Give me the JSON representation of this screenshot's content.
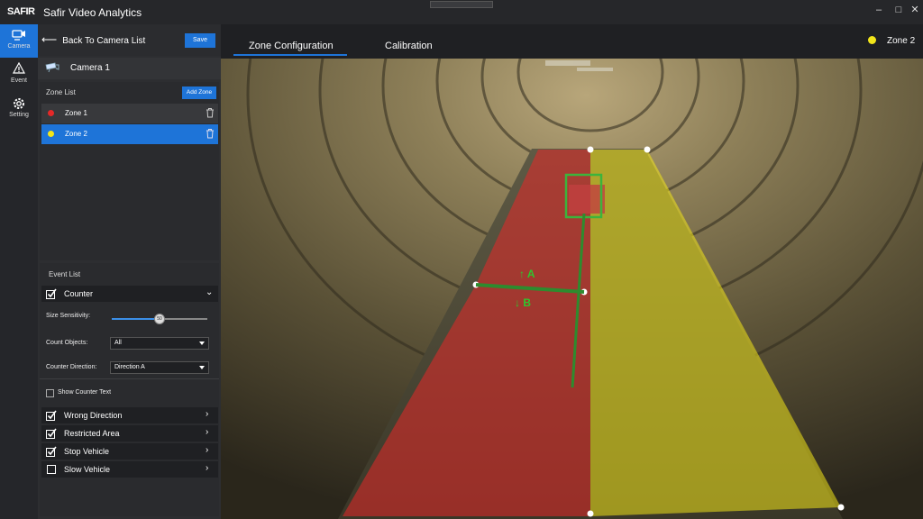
{
  "app": {
    "logo": "SAFIR",
    "title": "Safir Video Analytics"
  },
  "rail": {
    "items": [
      {
        "label": "Camera",
        "icon": "camera-icon"
      },
      {
        "label": "Event",
        "icon": "warning-icon"
      },
      {
        "label": "Setting",
        "icon": "gear-icon"
      }
    ]
  },
  "panel": {
    "back_label": "Back To Camera List",
    "save_label": "Save",
    "camera_name": "Camera 1",
    "zone_list_title": "Zone List",
    "add_zone_label": "Add Zone",
    "zones": [
      {
        "name": "Zone 1",
        "color": "#e52828"
      },
      {
        "name": "Zone 2",
        "color": "#f2e51a"
      }
    ],
    "event_list_title": "Event List",
    "counter": {
      "label": "Counter",
      "size_sensitivity_label": "Size Sensitivity:",
      "size_sensitivity_value": "50",
      "count_objects_label": "Count Objects:",
      "count_objects_value": "All",
      "counter_direction_label": "Counter Direction:",
      "counter_direction_value": "Direction A",
      "show_counter_text_label": "Show Counter Text"
    },
    "events": [
      {
        "label": "Wrong Direction",
        "checked": true
      },
      {
        "label": "Restricted Area",
        "checked": true
      },
      {
        "label": "Stop Vehicle",
        "checked": true
      },
      {
        "label": "Slow Vehicle",
        "checked": false
      }
    ]
  },
  "tabs": {
    "zone_config": "Zone Configuration",
    "calibration": "Calibration"
  },
  "active_zone": {
    "label": "Zone 2",
    "color": "#f2e51a"
  },
  "video": {
    "direction_a": "↑ A",
    "direction_b": "↓ B"
  },
  "colors": {
    "accent": "#1e74d8",
    "zone1": "#e52828",
    "zone2": "#f2e51a",
    "line": "#2e8b2e"
  }
}
